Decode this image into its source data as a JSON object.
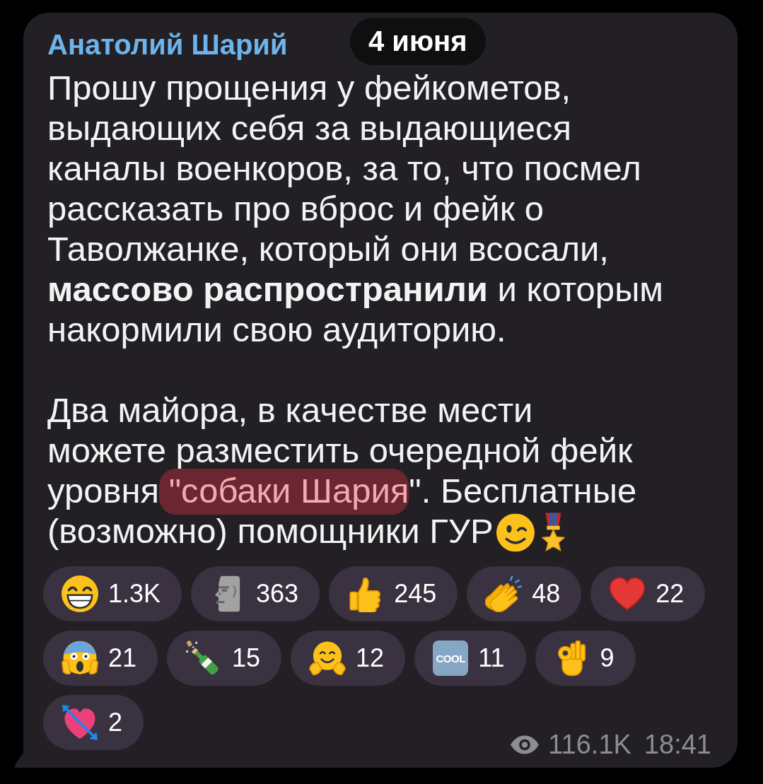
{
  "sender": {
    "name": "Анатолий Шарий"
  },
  "date_badge": {
    "text": "4 июня"
  },
  "message": {
    "paragraphs": [
      {
        "lines": [
          [
            {
              "text": "Прошу прощения у фейкометов,",
              "marked": false
            }
          ],
          [
            {
              "text": "выдающих себя за выдающиеся",
              "marked": false
            }
          ],
          [
            {
              "text": "каналы военкоров, за то, что посмел",
              "marked": false
            }
          ],
          [
            {
              "text": "рассказать про вброс и фейк о",
              "marked": false
            }
          ],
          [
            {
              "text": "Таволжанке, который они всосали,",
              "marked": false
            }
          ],
          [
            {
              "text": "**массово распространили** и которым",
              "marked": false
            }
          ],
          [
            {
              "text": "накормили свою аудиторию.",
              "marked": false
            }
          ]
        ]
      },
      {
        "lines": [
          [
            {
              "text": "Два майора, в качестве мести",
              "marked": false
            }
          ],
          [
            {
              "text": "можете разместить очередной фейк",
              "marked": false
            }
          ],
          [
            {
              "text": "уровня",
              "marked": false
            },
            {
              "text": " \"собаки Шария",
              "marked": true
            },
            {
              "text": "\". Бесплатные",
              "marked": false
            }
          ],
          [
            {
              "text": "(возможно) помощники ГУР",
              "marked": false
            }
          ]
        ],
        "trailing_emoji": [
          {
            "kind": "wink"
          },
          {
            "kind": "medal"
          }
        ]
      }
    ]
  },
  "reactions": [
    {
      "kind": "grin",
      "count": "1.3K",
      "selected": false
    },
    {
      "kind": "moai",
      "count": "363",
      "selected": false
    },
    {
      "kind": "thumbs_up",
      "count": "245",
      "selected": false
    },
    {
      "kind": "clap",
      "count": "48",
      "selected": false
    },
    {
      "kind": "heart",
      "count": "22",
      "selected": false
    },
    {
      "kind": "scream",
      "count": "21",
      "selected": false
    },
    {
      "kind": "champagne",
      "count": "15",
      "selected": false
    },
    {
      "kind": "hug",
      "count": "12",
      "selected": false
    },
    {
      "kind": "cool",
      "badge_text": "COOL",
      "count": "11",
      "selected": false
    },
    {
      "kind": "ok_hand",
      "count": "9",
      "selected": false
    },
    {
      "kind": "heart_arrow",
      "count": "2",
      "selected": false
    }
  ],
  "footer": {
    "views": "116.1K",
    "time": "18:41"
  }
}
